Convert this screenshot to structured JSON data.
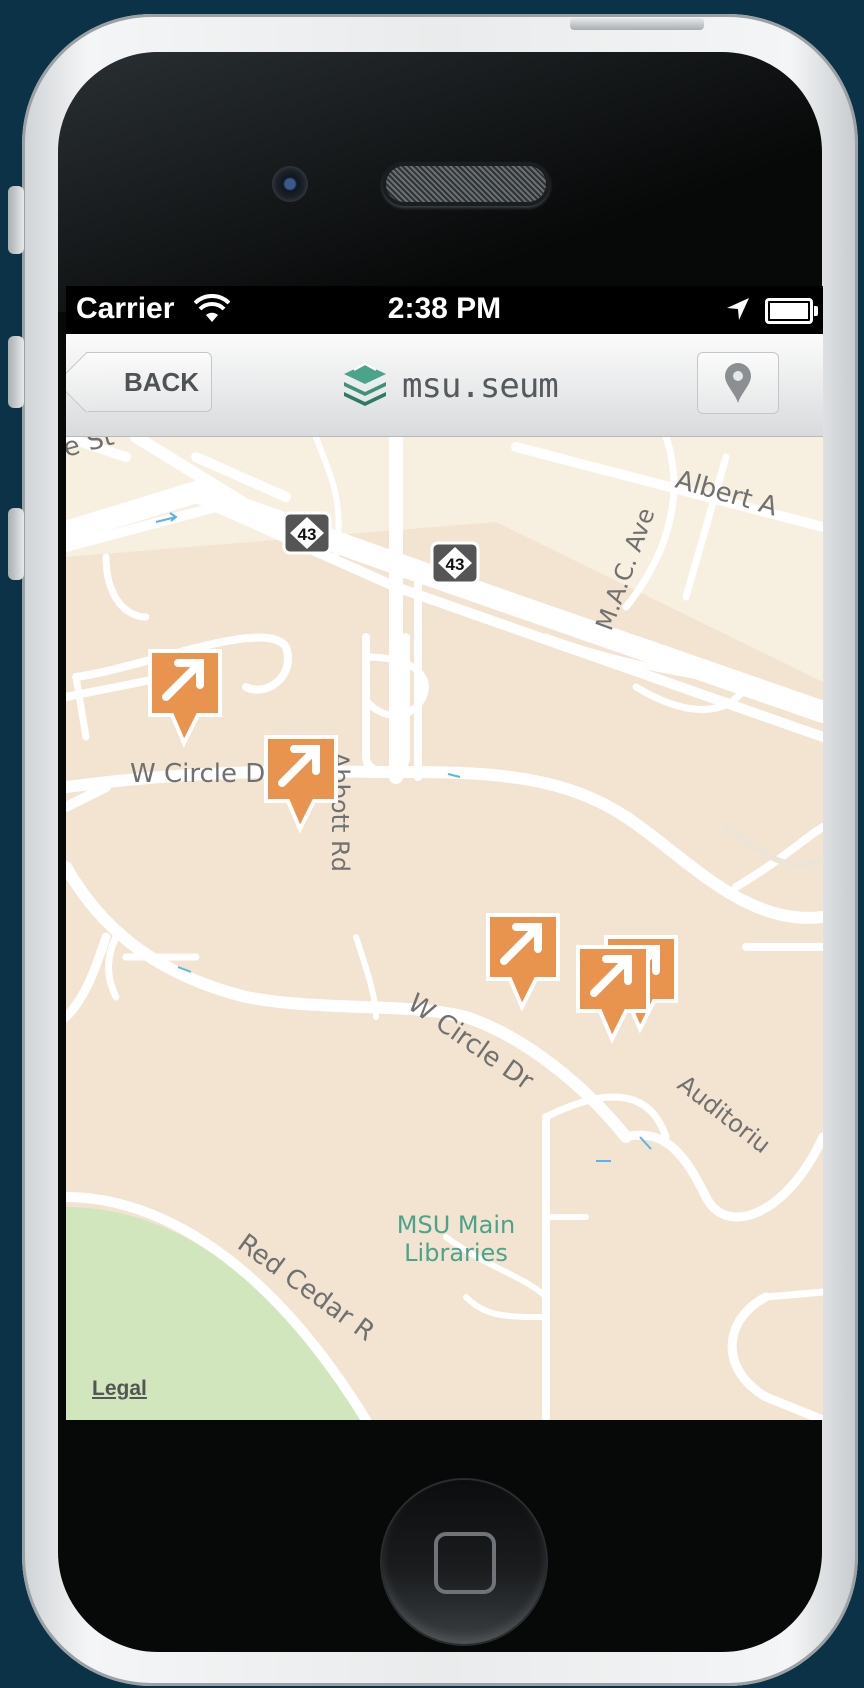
{
  "statusbar": {
    "carrier": "Carrier",
    "time": "2:38 PM",
    "icons": [
      "wifi-icon",
      "location-arrow-icon",
      "battery-icon"
    ]
  },
  "navbar": {
    "back_label": "BACK",
    "brand_text": "msu.seum",
    "brand_icon": "layers-logo-icon",
    "right_button_icon": "map-pin-icon"
  },
  "map": {
    "route_shields": [
      "43",
      "43"
    ],
    "street_labels": {
      "e_st": "e St",
      "albert": "Albert A",
      "mac_ave": "M.A.C. Ave",
      "w_circle_top": "W Circle D",
      "abbott": "Abbott Rd",
      "w_circle_lower": "W Circle Dr",
      "auditorium": "Auditoriu",
      "red_cedar": "Red Cedar R"
    },
    "poi": {
      "libraries_line1": "MSU Main",
      "libraries_line2": "Libraries"
    },
    "markers": [
      "marker-1",
      "marker-2",
      "marker-3",
      "marker-4",
      "marker-5"
    ],
    "legal_label": "Legal",
    "colors": {
      "land": "#f2e4d1",
      "campus": "#f2e4d1",
      "north_area": "#f6efdf",
      "park": "#d1e6bd",
      "road": "#ffffff",
      "marker": "#e8934e",
      "poi_text": "#4aa48c"
    }
  }
}
